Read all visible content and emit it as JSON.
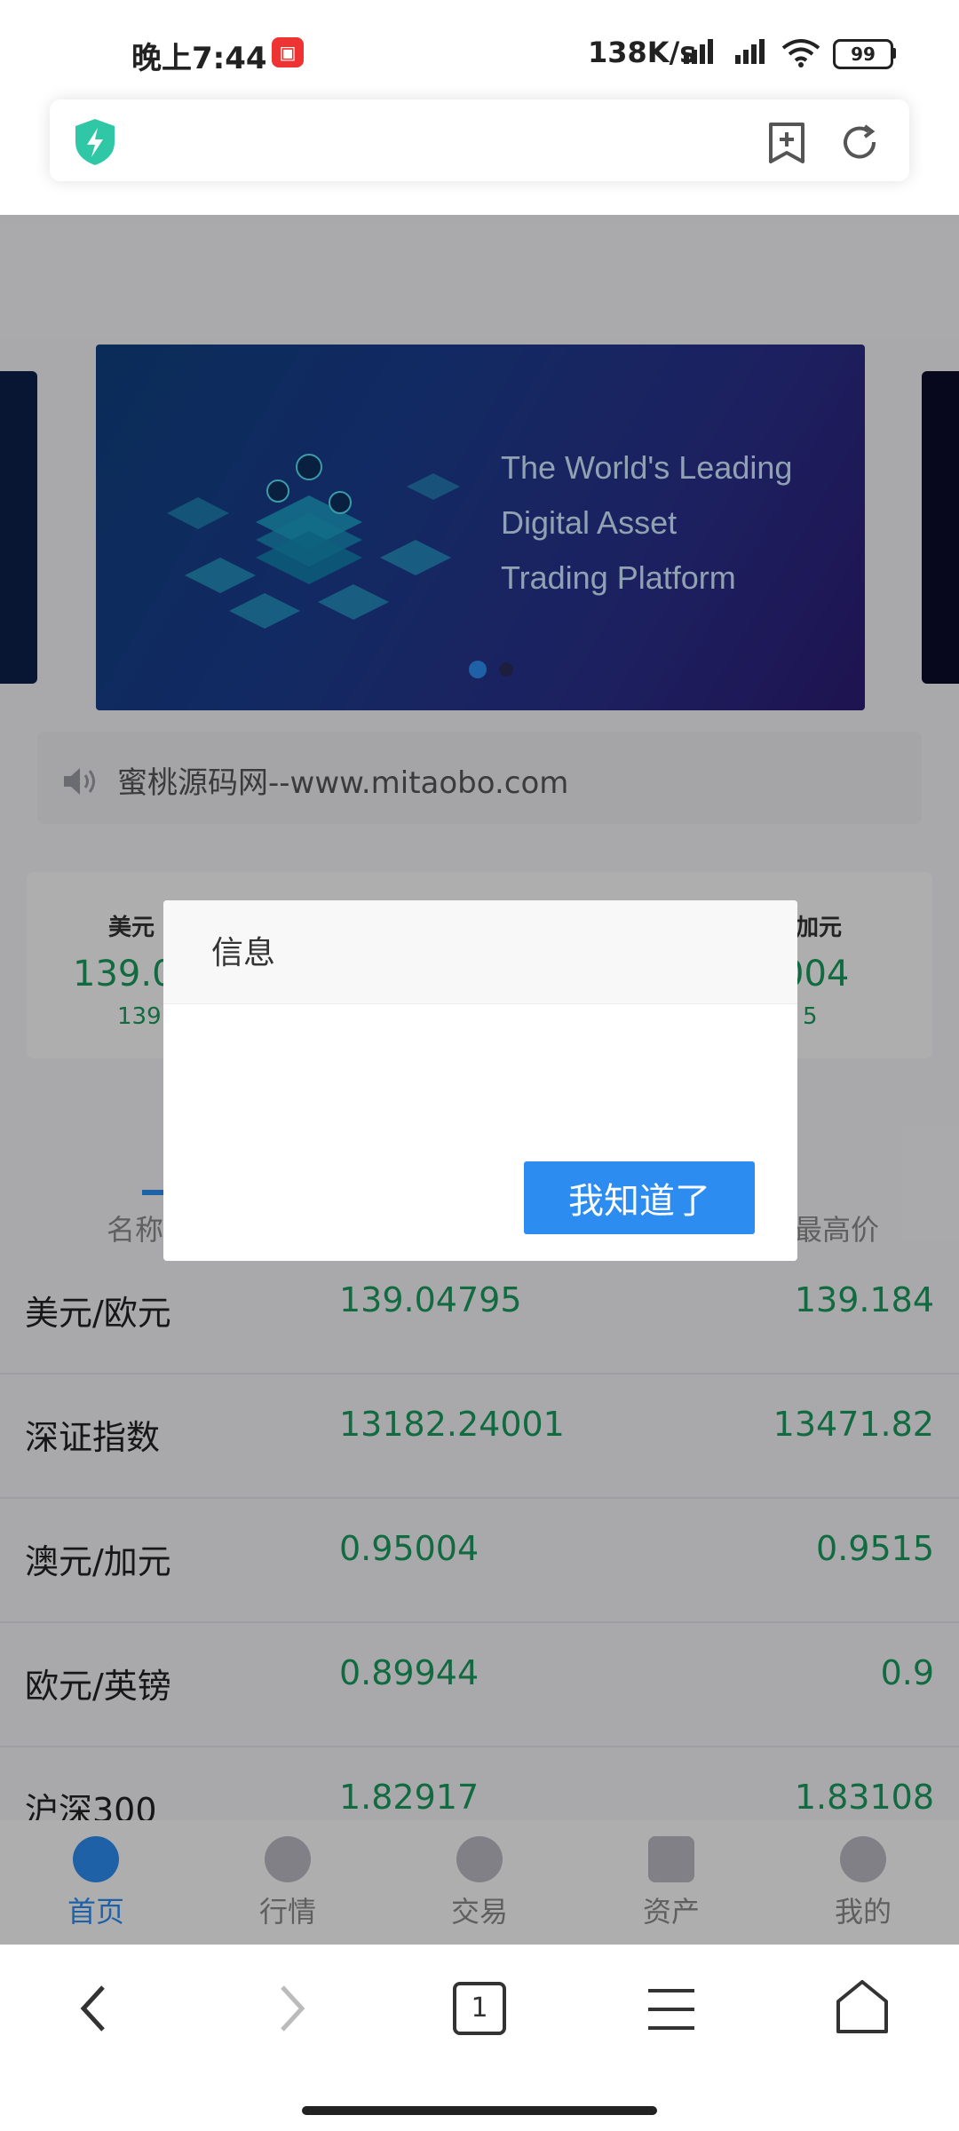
{
  "status_bar": {
    "time": "晚上7:44",
    "net_speed": "138K/s",
    "battery": "99"
  },
  "banner": {
    "lines": [
      "The World's Leading",
      "Digital Asset",
      "Trading Platform"
    ]
  },
  "notice": {
    "text": "蜜桃源码网--www.mitaobo.com"
  },
  "ticker": [
    {
      "name": "美元",
      "price": "139.0",
      "sub": "139"
    },
    {
      "name": "加元",
      "price": "004",
      "sub": "5"
    }
  ],
  "table_headers": {
    "name": "名称",
    "high": "最高价"
  },
  "market_rows": [
    {
      "name": "美元/欧元",
      "price": "139.04795",
      "high": "139.184"
    },
    {
      "name": "深证指数",
      "price": "13182.24001",
      "high": "13471.82"
    },
    {
      "name": "澳元/加元",
      "price": "0.95004",
      "high": "0.9515"
    },
    {
      "name": "欧元/英镑",
      "price": "0.89944",
      "high": "0.9"
    },
    {
      "name": "沪深300",
      "price": "1.82917",
      "high": "1.83108"
    }
  ],
  "tabs": [
    {
      "label": "首页",
      "active": true
    },
    {
      "label": "行情",
      "active": false
    },
    {
      "label": "交易",
      "active": false
    },
    {
      "label": "资产",
      "active": false
    },
    {
      "label": "我的",
      "active": false
    }
  ],
  "dialog": {
    "title": "信息",
    "button": "我知道了"
  },
  "browser_nav": {
    "tab_count": "1"
  },
  "colors": {
    "accent": "#2d8cf0",
    "price_green": "#1a9a5c"
  }
}
